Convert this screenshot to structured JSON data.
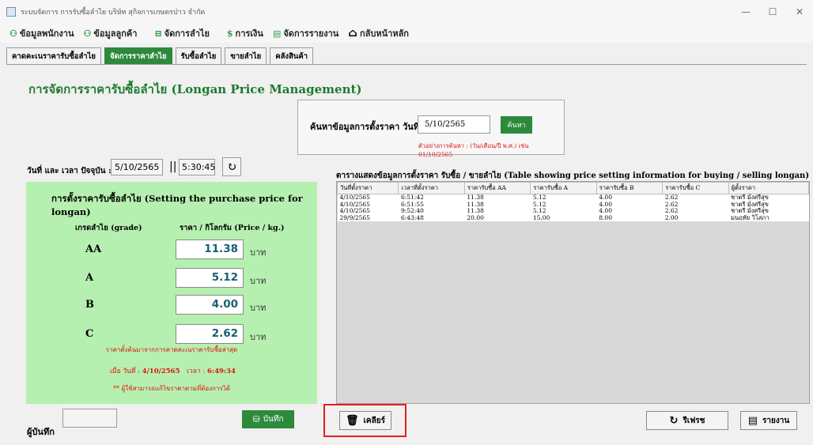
{
  "window": {
    "title": "ระบบจัดการ การรับซื้อลำไย บริษัท สุกิจการเกษตรป่าว จำกัด",
    "controls": [
      "—",
      "☐",
      "✕"
    ]
  },
  "menu": [
    {
      "icon": "employee-icon",
      "glyph": "⚇",
      "label": "ข้อมูลพนักงาน"
    },
    {
      "icon": "customer-icon",
      "glyph": "⚇",
      "label": "ข้อมูลลูกค้า"
    },
    {
      "icon": "cart-icon",
      "glyph": "⊟",
      "label": "จัดการลำไย"
    },
    {
      "icon": "dollar-icon",
      "glyph": "$",
      "label": "การเงิน"
    },
    {
      "icon": "report-icon",
      "glyph": "▤",
      "label": "จัดการรายงาน"
    },
    {
      "icon": "home-icon",
      "glyph": "⌂",
      "label": "กลับหน้าหลัก"
    }
  ],
  "tabs": [
    {
      "label": "คาดคะเนราคารับซื้อลำไย",
      "active": false
    },
    {
      "label": "จัดการราคาลำไย",
      "active": true
    },
    {
      "label": "รับซื้อลำไย",
      "active": false
    },
    {
      "label": "ขายลำไย",
      "active": false
    },
    {
      "label": "คลังสินค้า",
      "active": false
    }
  ],
  "page_title": "การจัดการราคารับซื้อลำไย (Longan Price Management)",
  "search": {
    "label": "ค้นหาข้อมูลการตั้งราคา  วันที่ :",
    "value": "5/10/2565",
    "button": "ค้นหา",
    "hint": "ตัวอย่างการค้นหา : (วัน/เดือน/ปี พ.ศ.) เช่น 01/10/2565"
  },
  "datetime": {
    "label": "วันที่ และ เวลา ปัจจุบัน :",
    "date": "5/10/2565",
    "separator": "||",
    "time": "5:30:45"
  },
  "price_panel": {
    "title": "การตั้งราคารับซื้อลำไย (Setting the purchase price for longan)",
    "col_grade": "เกรดลำไย (grade)",
    "col_price": "ราคา / กิโลกรัม (Price / kg.)",
    "unit": "บาท",
    "grades": [
      {
        "grade": "AA",
        "price": "11.38"
      },
      {
        "grade": "A",
        "price": "5.12"
      },
      {
        "grade": "B",
        "price": "4.00"
      },
      {
        "grade": "C",
        "price": "2.62"
      }
    ],
    "note1": "ราคาตั้งต้นมาจากการคาดคะเนราคารับซื้อล่าสุด",
    "note2_prefix": "เมื่อ วันที่ :",
    "note2_date": "4/10/2565",
    "note2_mid": "เวลา :",
    "note2_time": "6:49:34",
    "note3": "** ผู้ใช้สามารถแก้ไขราคาตามที่ต้องการได้"
  },
  "recorder_label": "ผู้บันทึก",
  "recorder_value": "",
  "save_button": "บันทึก",
  "table": {
    "title": "ตารางแสดงข้อมูลการตั้งราคา รับซื้อ / ขายลำไย (Table showing price setting information for buying / selling longan)",
    "headers": [
      "วันที่ตั้งราคา",
      "เวลาที่ตั้งราคา",
      "ราคารับซื้อ AA",
      "ราคารับซื้อ A",
      "ราคารับซื้อ B",
      "ราคารับซื้อ C",
      "ผู้ตั้งราคา"
    ],
    "rows": [
      [
        "4/10/2565",
        "6:51:42",
        "11.38",
        "5.12",
        "4.00",
        "2.62",
        "ชาตรี มั่งศรีสุข"
      ],
      [
        "4/10/2565",
        "6:51:55",
        "11.38",
        "5.12",
        "4.00",
        "2.62",
        "ชาตรี มั่งศรีสุข"
      ],
      [
        "4/10/2565",
        "9:52:40",
        "11.38",
        "5.12",
        "4.00",
        "2.62",
        "ชาตรี มั่งศรีสุข"
      ],
      [
        "29/9/2565",
        "6:43:48",
        "20.00",
        "15.00",
        "8.00",
        "2.00",
        "มนฤทัย วิโสภา"
      ]
    ]
  },
  "buttons": {
    "clear": "เคลียร์",
    "refresh": "รีเฟรช",
    "report": "รายงาน"
  },
  "highlight_color": "#e02020",
  "accent_color": "#2d8a3b"
}
